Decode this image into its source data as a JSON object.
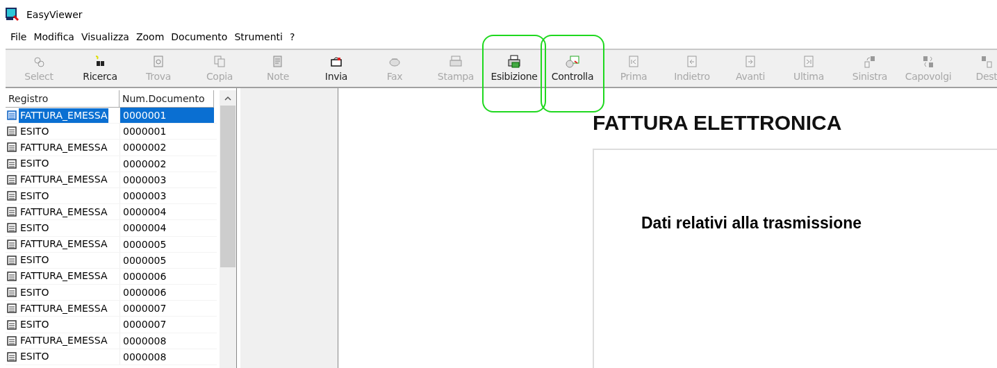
{
  "window": {
    "title": "EasyViewer"
  },
  "menu": [
    "File",
    "Modifica",
    "Visualizza",
    "Zoom",
    "Documento",
    "Strumenti",
    "?"
  ],
  "toolbar": [
    {
      "kind": "button",
      "label": "Select",
      "disabled": true,
      "highlighted": false
    },
    {
      "kind": "separator"
    },
    {
      "kind": "button",
      "label": "Ricerca",
      "disabled": false,
      "highlighted": false
    },
    {
      "kind": "button",
      "label": "Trova",
      "disabled": true,
      "highlighted": false
    },
    {
      "kind": "separator"
    },
    {
      "kind": "button",
      "label": "Copia",
      "disabled": true,
      "highlighted": false
    },
    {
      "kind": "button",
      "label": "Note",
      "disabled": true,
      "highlighted": false
    },
    {
      "kind": "button",
      "label": "Invia",
      "disabled": false,
      "highlighted": false
    },
    {
      "kind": "button",
      "label": "Fax",
      "disabled": true,
      "highlighted": false
    },
    {
      "kind": "separator"
    },
    {
      "kind": "button",
      "label": "Stampa",
      "disabled": true,
      "highlighted": false
    },
    {
      "kind": "button",
      "label": "Esibizione",
      "disabled": false,
      "highlighted": true
    },
    {
      "kind": "button",
      "label": "Controlla",
      "disabled": false,
      "highlighted": true
    },
    {
      "kind": "separator"
    },
    {
      "kind": "button",
      "label": "Prima",
      "disabled": true,
      "highlighted": false
    },
    {
      "kind": "button",
      "label": "Indietro",
      "disabled": true,
      "highlighted": false
    },
    {
      "kind": "button",
      "label": "Avanti",
      "disabled": true,
      "highlighted": false
    },
    {
      "kind": "button",
      "label": "Ultima",
      "disabled": true,
      "highlighted": false
    },
    {
      "kind": "separator"
    },
    {
      "kind": "button",
      "label": "Sinistra",
      "disabled": true,
      "highlighted": false
    },
    {
      "kind": "button",
      "label": "Capovolgi",
      "disabled": true,
      "highlighted": false
    },
    {
      "kind": "button",
      "label": "Dest",
      "disabled": true,
      "highlighted": false
    }
  ],
  "list": {
    "columns": [
      "Registro",
      "Num.Documento"
    ],
    "rows": [
      {
        "registro": "FATTURA_EMESSA",
        "numero": "0000001",
        "selected": true
      },
      {
        "registro": "ESITO",
        "numero": "0000001",
        "selected": false
      },
      {
        "registro": "FATTURA_EMESSA",
        "numero": "0000002",
        "selected": false
      },
      {
        "registro": "ESITO",
        "numero": "0000002",
        "selected": false
      },
      {
        "registro": "FATTURA_EMESSA",
        "numero": "0000003",
        "selected": false
      },
      {
        "registro": "ESITO",
        "numero": "0000003",
        "selected": false
      },
      {
        "registro": "FATTURA_EMESSA",
        "numero": "0000004",
        "selected": false
      },
      {
        "registro": "ESITO",
        "numero": "0000004",
        "selected": false
      },
      {
        "registro": "FATTURA_EMESSA",
        "numero": "0000005",
        "selected": false
      },
      {
        "registro": "ESITO",
        "numero": "0000005",
        "selected": false
      },
      {
        "registro": "FATTURA_EMESSA",
        "numero": "0000006",
        "selected": false
      },
      {
        "registro": "ESITO",
        "numero": "0000006",
        "selected": false
      },
      {
        "registro": "FATTURA_EMESSA",
        "numero": "0000007",
        "selected": false
      },
      {
        "registro": "ESITO",
        "numero": "0000007",
        "selected": false
      },
      {
        "registro": "FATTURA_EMESSA",
        "numero": "0000008",
        "selected": false
      },
      {
        "registro": "ESITO",
        "numero": "0000008",
        "selected": false
      }
    ]
  },
  "document": {
    "title": "FATTURA ELETTRONICA",
    "section_heading": "Dati relativi alla trasmissione"
  }
}
